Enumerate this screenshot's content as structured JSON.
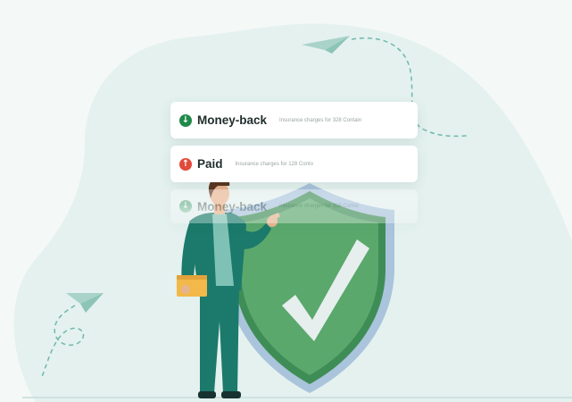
{
  "notifications": [
    {
      "direction": "down",
      "title": "Money-back",
      "description": "Insurance charges for 328 Contain",
      "icon": "arrow-down-icon",
      "color": "#1e8a4a"
    },
    {
      "direction": "up",
      "title": "Paid",
      "description": "Insurance charges for 128 Conto",
      "icon": "arrow-up-icon",
      "color": "#e24a3b"
    },
    {
      "direction": "down",
      "title": "Money-back",
      "description": "Insurance charges for 328 Contai",
      "icon": "arrow-down-icon",
      "color": "#1e8a4a"
    }
  ],
  "colors": {
    "background": "#f4f8f7",
    "blob": "#e4f1ef",
    "shield_outer": "#aac4dc",
    "shield_inner": "#5aa86c",
    "check": "#e6eeee",
    "suit": "#1b7a6b"
  },
  "illustration": {
    "shield_icon": "shield-check-icon",
    "person_icon": "businessman-icon",
    "plane_icon": "paper-plane-icon"
  }
}
